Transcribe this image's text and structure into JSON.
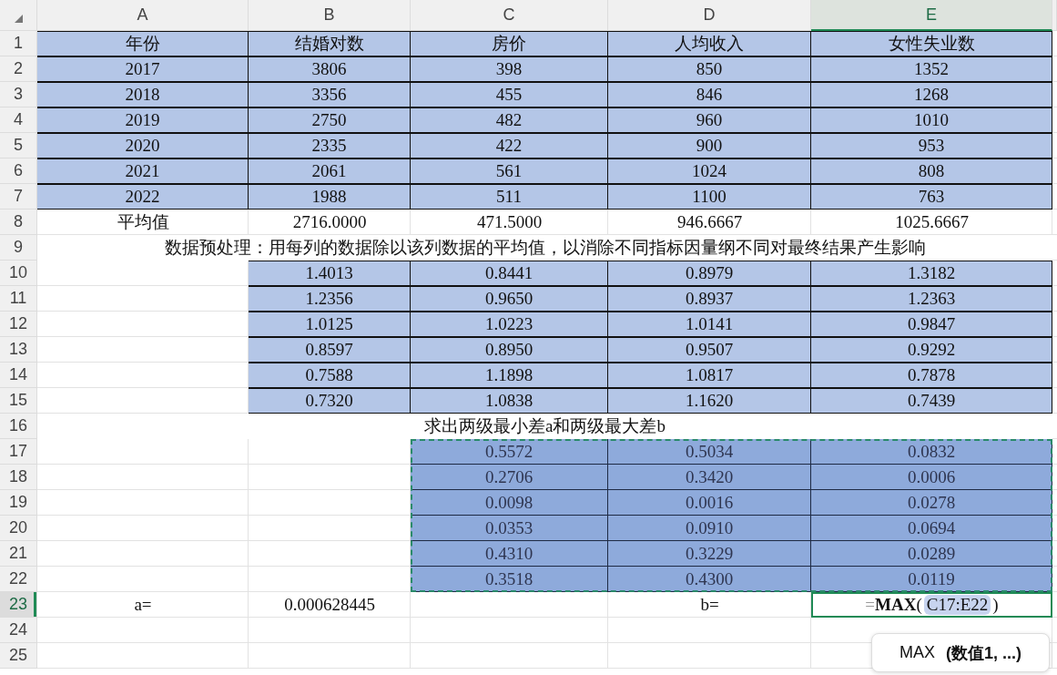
{
  "columns": [
    {
      "label": "A",
      "selected": false
    },
    {
      "label": "B",
      "selected": false
    },
    {
      "label": "C",
      "selected": false
    },
    {
      "label": "D",
      "selected": false
    },
    {
      "label": "E",
      "selected": true
    }
  ],
  "rows": [
    {
      "number": "1",
      "selected": false,
      "kind": "cells",
      "cells": [
        {
          "kind": "data",
          "text": "年份"
        },
        {
          "kind": "data",
          "text": "结婚对数"
        },
        {
          "kind": "data",
          "text": "房价"
        },
        {
          "kind": "data",
          "text": "人均收入"
        },
        {
          "kind": "data",
          "text": "女性失业数"
        }
      ]
    },
    {
      "number": "2",
      "selected": false,
      "kind": "cells",
      "cells": [
        {
          "kind": "data",
          "text": "2017"
        },
        {
          "kind": "data",
          "text": "3806"
        },
        {
          "kind": "data",
          "text": "398"
        },
        {
          "kind": "data",
          "text": "850"
        },
        {
          "kind": "data",
          "text": "1352"
        }
      ]
    },
    {
      "number": "3",
      "selected": false,
      "kind": "cells",
      "cells": [
        {
          "kind": "data",
          "text": "2018"
        },
        {
          "kind": "data",
          "text": "3356"
        },
        {
          "kind": "data",
          "text": "455"
        },
        {
          "kind": "data",
          "text": "846"
        },
        {
          "kind": "data",
          "text": "1268"
        }
      ]
    },
    {
      "number": "4",
      "selected": false,
      "kind": "cells",
      "cells": [
        {
          "kind": "data",
          "text": "2019"
        },
        {
          "kind": "data",
          "text": "2750"
        },
        {
          "kind": "data",
          "text": "482"
        },
        {
          "kind": "data",
          "text": "960"
        },
        {
          "kind": "data",
          "text": "1010"
        }
      ]
    },
    {
      "number": "5",
      "selected": false,
      "kind": "cells",
      "cells": [
        {
          "kind": "data",
          "text": "2020"
        },
        {
          "kind": "data",
          "text": "2335"
        },
        {
          "kind": "data",
          "text": "422"
        },
        {
          "kind": "data",
          "text": "900"
        },
        {
          "kind": "data",
          "text": "953"
        }
      ]
    },
    {
      "number": "6",
      "selected": false,
      "kind": "cells",
      "cells": [
        {
          "kind": "data",
          "text": "2021"
        },
        {
          "kind": "data",
          "text": "2061"
        },
        {
          "kind": "data",
          "text": "561"
        },
        {
          "kind": "data",
          "text": "1024"
        },
        {
          "kind": "data",
          "text": "808"
        }
      ]
    },
    {
      "number": "7",
      "selected": false,
      "kind": "cells",
      "cells": [
        {
          "kind": "data",
          "text": "2022"
        },
        {
          "kind": "data",
          "text": "1988"
        },
        {
          "kind": "data",
          "text": "511"
        },
        {
          "kind": "data",
          "text": "1100"
        },
        {
          "kind": "data",
          "text": "763"
        }
      ]
    },
    {
      "number": "8",
      "selected": false,
      "kind": "cells",
      "cells": [
        {
          "kind": "plain",
          "text": "平均值"
        },
        {
          "kind": "plain",
          "text": "2716.0000"
        },
        {
          "kind": "plain",
          "text": "471.5000"
        },
        {
          "kind": "plain",
          "text": "946.6667"
        },
        {
          "kind": "plain",
          "text": "1025.6667"
        }
      ]
    },
    {
      "number": "9",
      "selected": false,
      "kind": "merged",
      "text": "数据预处理：用每列的数据除以该列数据的平均值，以消除不同指标因量纲不同对最终结果产生影响"
    },
    {
      "number": "10",
      "selected": false,
      "kind": "cells",
      "cells": [
        {
          "kind": "plain"
        },
        {
          "kind": "data",
          "text": "1.4013"
        },
        {
          "kind": "data",
          "text": "0.8441"
        },
        {
          "kind": "data",
          "text": "0.8979"
        },
        {
          "kind": "data",
          "text": "1.3182"
        }
      ]
    },
    {
      "number": "11",
      "selected": false,
      "kind": "cells",
      "cells": [
        {
          "kind": "plain"
        },
        {
          "kind": "data",
          "text": "1.2356"
        },
        {
          "kind": "data",
          "text": "0.9650"
        },
        {
          "kind": "data",
          "text": "0.8937"
        },
        {
          "kind": "data",
          "text": "1.2363"
        }
      ]
    },
    {
      "number": "12",
      "selected": false,
      "kind": "cells",
      "cells": [
        {
          "kind": "plain"
        },
        {
          "kind": "data",
          "text": "1.0125"
        },
        {
          "kind": "data",
          "text": "1.0223"
        },
        {
          "kind": "data",
          "text": "1.0141"
        },
        {
          "kind": "data",
          "text": "0.9847"
        }
      ]
    },
    {
      "number": "13",
      "selected": false,
      "kind": "cells",
      "cells": [
        {
          "kind": "plain"
        },
        {
          "kind": "data",
          "text": "0.8597"
        },
        {
          "kind": "data",
          "text": "0.8950"
        },
        {
          "kind": "data",
          "text": "0.9507"
        },
        {
          "kind": "data",
          "text": "0.9292"
        }
      ]
    },
    {
      "number": "14",
      "selected": false,
      "kind": "cells",
      "cells": [
        {
          "kind": "plain"
        },
        {
          "kind": "data",
          "text": "0.7588"
        },
        {
          "kind": "data",
          "text": "1.1898"
        },
        {
          "kind": "data",
          "text": "1.0817"
        },
        {
          "kind": "data",
          "text": "0.7878"
        }
      ]
    },
    {
      "number": "15",
      "selected": false,
      "kind": "cells",
      "cells": [
        {
          "kind": "plain"
        },
        {
          "kind": "data",
          "text": "0.7320"
        },
        {
          "kind": "data",
          "text": "1.0838"
        },
        {
          "kind": "data",
          "text": "1.1620"
        },
        {
          "kind": "data",
          "text": "0.7439"
        }
      ]
    },
    {
      "number": "16",
      "selected": false,
      "kind": "merged",
      "text": "求出两级最小差a和两级最大差b"
    },
    {
      "number": "17",
      "selected": false,
      "kind": "cells",
      "cells": [
        {
          "kind": "plain"
        },
        {
          "kind": "plain"
        },
        {
          "kind": "range",
          "text": "0.5572"
        },
        {
          "kind": "range",
          "text": "0.5034"
        },
        {
          "kind": "range",
          "text": "0.0832"
        }
      ]
    },
    {
      "number": "18",
      "selected": false,
      "kind": "cells",
      "cells": [
        {
          "kind": "plain"
        },
        {
          "kind": "plain"
        },
        {
          "kind": "range",
          "text": "0.2706"
        },
        {
          "kind": "range",
          "text": "0.3420"
        },
        {
          "kind": "range",
          "text": "0.0006"
        }
      ]
    },
    {
      "number": "19",
      "selected": false,
      "kind": "cells",
      "cells": [
        {
          "kind": "plain"
        },
        {
          "kind": "plain"
        },
        {
          "kind": "range",
          "text": "0.0098"
        },
        {
          "kind": "range",
          "text": "0.0016"
        },
        {
          "kind": "range",
          "text": "0.0278"
        }
      ]
    },
    {
      "number": "20",
      "selected": false,
      "kind": "cells",
      "cells": [
        {
          "kind": "plain"
        },
        {
          "kind": "plain"
        },
        {
          "kind": "range",
          "text": "0.0353"
        },
        {
          "kind": "range",
          "text": "0.0910"
        },
        {
          "kind": "range",
          "text": "0.0694"
        }
      ]
    },
    {
      "number": "21",
      "selected": false,
      "kind": "cells",
      "cells": [
        {
          "kind": "plain"
        },
        {
          "kind": "plain"
        },
        {
          "kind": "range",
          "text": "0.4310"
        },
        {
          "kind": "range",
          "text": "0.3229"
        },
        {
          "kind": "range",
          "text": "0.0289"
        }
      ]
    },
    {
      "number": "22",
      "selected": false,
      "kind": "cells",
      "cells": [
        {
          "kind": "plain"
        },
        {
          "kind": "plain"
        },
        {
          "kind": "range",
          "text": "0.3518"
        },
        {
          "kind": "range",
          "text": "0.4300"
        },
        {
          "kind": "range",
          "text": "0.0119"
        }
      ]
    },
    {
      "number": "23",
      "selected": true,
      "kind": "cells",
      "cells": [
        {
          "kind": "plain",
          "text": "a="
        },
        {
          "kind": "plain",
          "text": "0.000628445"
        },
        {
          "kind": "plain"
        },
        {
          "kind": "plain",
          "text": "b="
        },
        {
          "kind": "formula",
          "formula": {
            "equals": "=",
            "function": "MAX",
            "open": "(",
            "reference": "C17:E22",
            "close": ")"
          }
        }
      ]
    },
    {
      "number": "24",
      "selected": false,
      "kind": "cells",
      "cells": [
        {
          "kind": "plain"
        },
        {
          "kind": "plain"
        },
        {
          "kind": "plain"
        },
        {
          "kind": "plain"
        },
        {
          "kind": "plain"
        }
      ]
    },
    {
      "number": "25",
      "selected": false,
      "kind": "cells",
      "cells": [
        {
          "kind": "plain"
        },
        {
          "kind": "plain"
        },
        {
          "kind": "plain"
        },
        {
          "kind": "plain"
        },
        {
          "kind": "plain"
        }
      ]
    }
  ],
  "tooltip": {
    "function": "MAX",
    "arguments": "(数值1, ...)"
  }
}
